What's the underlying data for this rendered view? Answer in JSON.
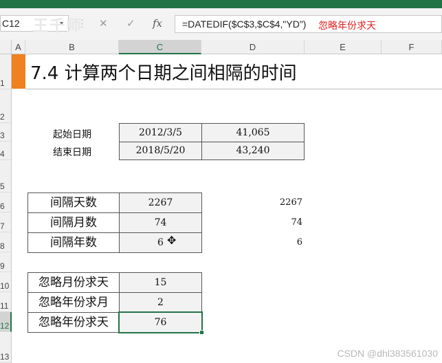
{
  "formula_bar": {
    "name_box": "C12",
    "formula": "=DATEDIF($C$3,$C$4,\"YD\")",
    "annotation": "忽略年份求天",
    "cancel_icon": "✕",
    "enter_icon": "✓",
    "function_icon": "fx",
    "logo_text": "王千师"
  },
  "columns": [
    "A",
    "B",
    "C",
    "D",
    "E",
    "F"
  ],
  "rows": [
    "1",
    "2",
    "3",
    "4",
    "5",
    "6",
    "7",
    "8",
    "9",
    "10",
    "11",
    "12",
    "13"
  ],
  "selected": {
    "column": "C",
    "row": "12"
  },
  "title": "7.4 计算两个日期之间相隔的时间",
  "dates": [
    {
      "label": "起始日期",
      "date": "2012/3/5",
      "serial": "41,065"
    },
    {
      "label": "结束日期",
      "date": "2018/5/20",
      "serial": "43,240"
    }
  ],
  "intervals": [
    {
      "label": "间隔天数",
      "value": "2267",
      "value_d": "2267"
    },
    {
      "label": "间隔月数",
      "value": "74",
      "value_d": "74"
    },
    {
      "label": "间隔年数",
      "value": "6",
      "value_d": "6"
    }
  ],
  "ignore": [
    {
      "label": "忽略月份求天",
      "value": "15"
    },
    {
      "label": "忽略年份求月",
      "value": "2"
    },
    {
      "label": "忽略年份求天",
      "value": "76"
    }
  ],
  "watermark": "CSDN @dhl383561030",
  "colors": {
    "excel_green": "#217346",
    "title_accent": "#f08020",
    "annotation_red": "#e02020"
  }
}
